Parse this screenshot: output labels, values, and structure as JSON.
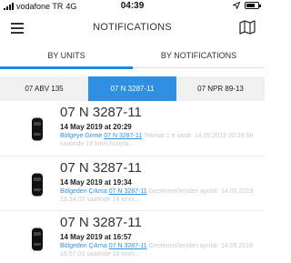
{
  "status_bar": {
    "carrier": "vodafone TR",
    "network": "4G",
    "time": "04:39",
    "battery_level": 0.75
  },
  "header": {
    "title": "NOTIFICATIONS",
    "menu_icon": "hamburger-menu-icon",
    "map_icon": "map-icon"
  },
  "segment": {
    "tabs": [
      {
        "label": "BY UNITS",
        "selected": true
      },
      {
        "label": "BY NOTIFICATIONS",
        "selected": false
      }
    ],
    "accent": "#1e88e5"
  },
  "plates": [
    {
      "label": "07 ABV 135",
      "selected": false
    },
    {
      "label": "07 N 3287-11",
      "selected": true
    },
    {
      "label": "07 NPR 89-13",
      "selected": false
    }
  ],
  "notifications": [
    {
      "unit": "07 N 3287-11",
      "time": "14 May 2019 at 20:29",
      "event": "Bölgeye Girme",
      "plate_link": "07 N 3287-11",
      "rest": "Tekmar 1 e vardı. 14.05.2019 20:28:58 saatinde 18 km/s hızıyla..."
    },
    {
      "unit": "07 N 3287-11",
      "time": "14 May 2019 at 19:34",
      "event": "Bölgeden Çıkma",
      "plate_link": "07 N 3287-11",
      "rest": "Geofence(ler)den ayrıldı. 14.05.2019 19:34:03 saatinde 18 km/s..."
    },
    {
      "unit": "07 N 3287-11",
      "time": "14 May 2019 at 16:57",
      "event": "Bölgeden Çıkma",
      "plate_link": "07 N 3287-11",
      "rest": "Geofence(ler)den ayrıldı. 14.05.2019 16:57:03 saatinde 18 km/s..."
    }
  ],
  "colors": {
    "link": "#2f8fe3",
    "selected_plate_bg": "#2f8fe3",
    "muted_text": "#c9c9c9"
  }
}
